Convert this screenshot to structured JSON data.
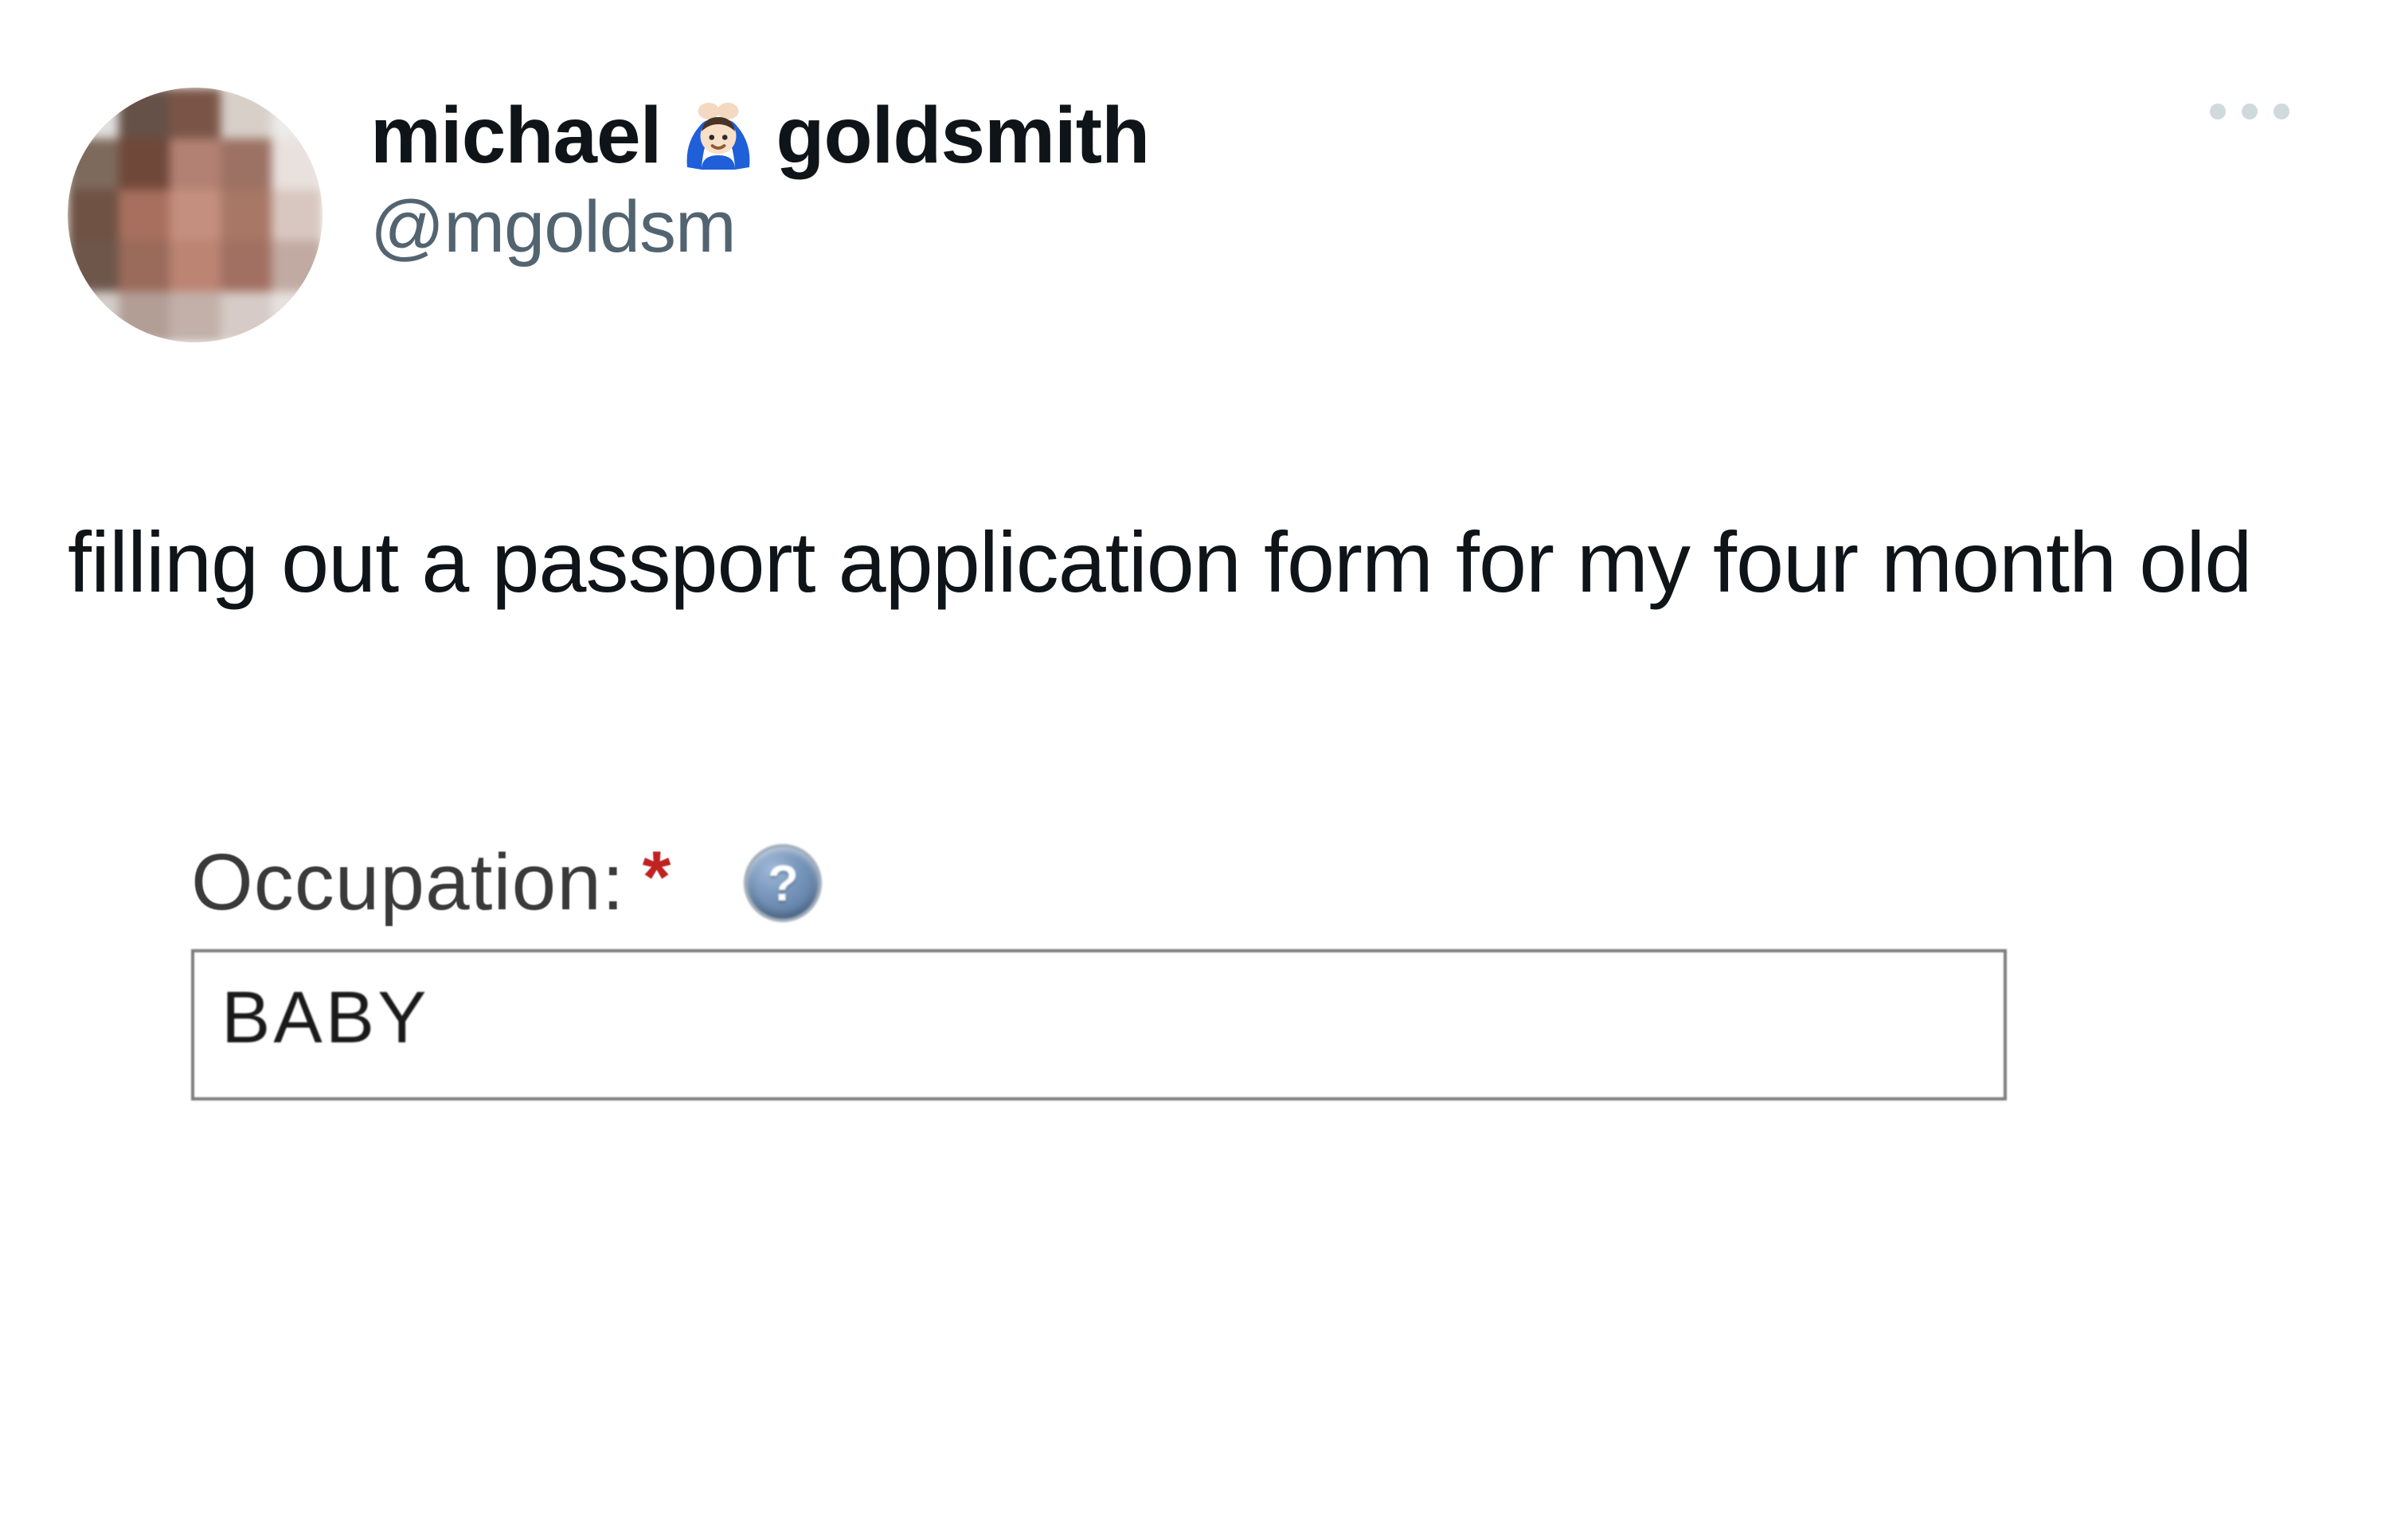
{
  "tweet": {
    "author": {
      "display_name_first": "michael",
      "display_name_last": "goldsmith",
      "emoji_name": "person-gesturing-ok-light-skin",
      "handle": "@mgoldsm"
    },
    "text": "filling out a passport application form for my four month old"
  },
  "form": {
    "field_label": "Occupation:",
    "required_marker": "*",
    "help_icon_label": "?",
    "input_value": "BABY"
  }
}
